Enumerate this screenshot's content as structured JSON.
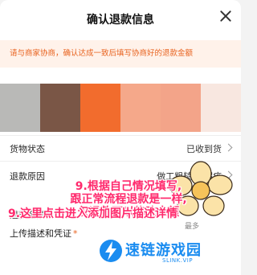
{
  "header": {
    "title": "确认退款信息"
  },
  "notice": {
    "text": "请与商家协商，确认达成一致后填写协商好的退款金额"
  },
  "swatches": [
    "#b9b9b7",
    "#7a5646",
    "#f26c2d",
    "#f5a88a",
    "#f3a489",
    "#f8e7e0"
  ],
  "rows": [
    {
      "label": "货物状态",
      "value": "已收到货"
    },
    {
      "label": "退款原因",
      "value": "做工粗糙/有瑕疵"
    }
  ],
  "amount": {
    "label": "退款金额",
    "max": "最多"
  },
  "upload": {
    "label": "上传描述和凭证",
    "star": "*"
  },
  "annotations": {
    "line1": "9.根据自己情况填写,",
    "line2": "跟正常流程退款是一样,",
    "line3": "仅退款可以修改金额",
    "step": "9.这里点击进入添加图片描述详情"
  },
  "watermark": {
    "name": "速链游戏园",
    "url": "SLINK.VIP"
  },
  "colors": {
    "accent": "#e8621e",
    "annotation": "#ff2a6d",
    "watermark": "#1a8cf0"
  }
}
